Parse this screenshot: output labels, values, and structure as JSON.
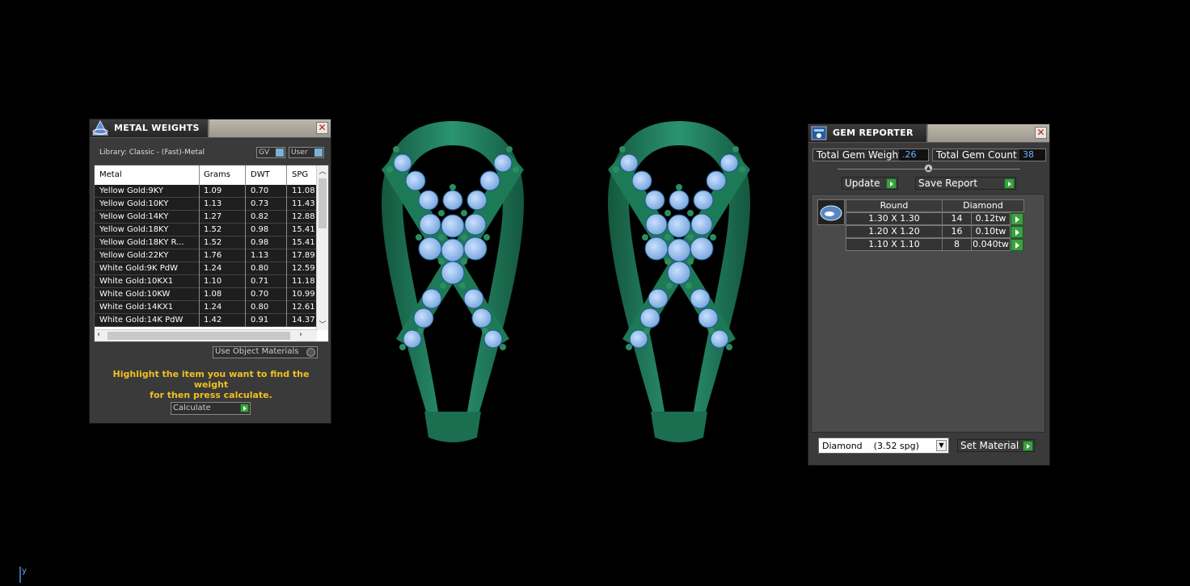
{
  "metal_weights": {
    "title": "METAL WEIGHTS",
    "library": "Library: Classic - (Fast)-Metal",
    "toggle_gv": "GV",
    "toggle_user": "User",
    "columns": [
      "Metal",
      "Grams",
      "DWT",
      "SPG"
    ],
    "rows": [
      {
        "metal": "Yellow Gold:9KY",
        "grams": "1.09",
        "dwt": "0.70",
        "spg": "11.08"
      },
      {
        "metal": "Yellow Gold:10KY",
        "grams": "1.13",
        "dwt": "0.73",
        "spg": "11.43"
      },
      {
        "metal": "Yellow Gold:14KY",
        "grams": "1.27",
        "dwt": "0.82",
        "spg": "12.88"
      },
      {
        "metal": "Yellow Gold:18KY",
        "grams": "1.52",
        "dwt": "0.98",
        "spg": "15.41"
      },
      {
        "metal": "Yellow Gold:18KY R...",
        "grams": "1.52",
        "dwt": "0.98",
        "spg": "15.41"
      },
      {
        "metal": "Yellow Gold:22KY",
        "grams": "1.76",
        "dwt": "1.13",
        "spg": "17.89"
      },
      {
        "metal": "White Gold:9K PdW",
        "grams": "1.24",
        "dwt": "0.80",
        "spg": "12.59"
      },
      {
        "metal": "White Gold:10KX1",
        "grams": "1.10",
        "dwt": "0.71",
        "spg": "11.18"
      },
      {
        "metal": "White Gold:10KW",
        "grams": "1.08",
        "dwt": "0.70",
        "spg": "10.99"
      },
      {
        "metal": "White Gold:14KX1",
        "grams": "1.24",
        "dwt": "0.80",
        "spg": "12.61"
      },
      {
        "metal": "White Gold:14K PdW",
        "grams": "1.42",
        "dwt": "0.91",
        "spg": "14.37"
      }
    ],
    "use_object_materials": "Use Object Materials",
    "hint_line1": "Highlight the item you want to find the weight",
    "hint_line2": "for then press calculate.",
    "calculate": "Calculate"
  },
  "gem_reporter": {
    "title": "GEM REPORTER",
    "total_weight_label": "Total Gem Weight",
    "total_weight_value": ".26",
    "total_count_label": "Total Gem Count",
    "total_count_value": "38",
    "update": "Update",
    "save_report": "Save Report",
    "shape_header": "Round",
    "material_header": "Diamond",
    "rows": [
      {
        "size": "1.30 X 1.30",
        "count": "14",
        "weight": "0.12tw"
      },
      {
        "size": "1.20 X 1.20",
        "count": "16",
        "weight": "0.10tw"
      },
      {
        "size": "1.10 X 1.10",
        "count": "8",
        "weight": "0.040tw"
      }
    ],
    "material_select": "Diamond    (3.52 spg)",
    "set_material": "Set Material"
  },
  "viewport": {
    "axis_label": "y"
  },
  "colors": {
    "metal": "#1f7a58",
    "gem": "#8ab8ee",
    "panel": "#3a3a3a"
  }
}
